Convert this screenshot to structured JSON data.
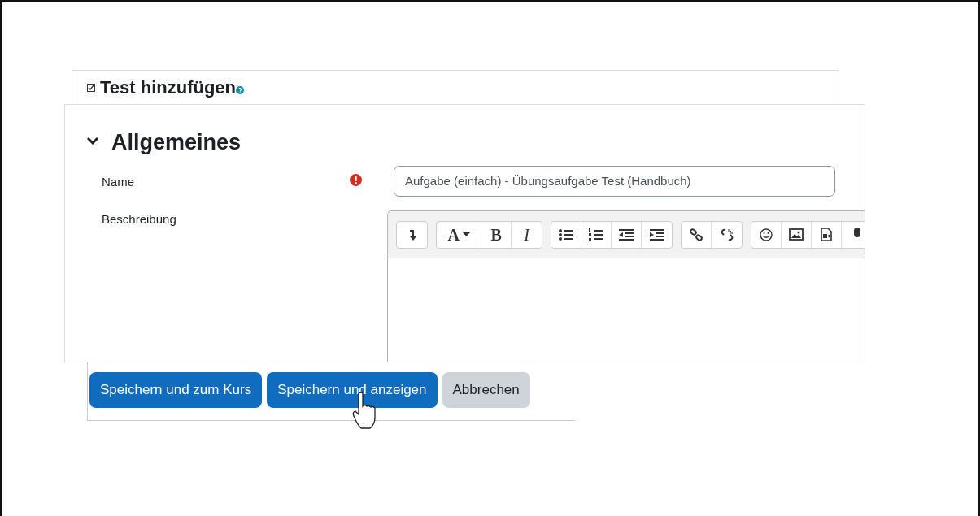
{
  "header": {
    "title": "Test hinzufügen"
  },
  "section": {
    "title": "Allgemeines",
    "expanded": true
  },
  "fields": [
    {
      "kind": "text",
      "label": "Name",
      "required": true,
      "value": "Aufgabe (einfach) - Übungsaufgabe Test (Handbuch)"
    },
    {
      "kind": "editor",
      "label": "Beschreibung",
      "required": false
    }
  ],
  "toolbar": [
    [
      {
        "kind": "collapse"
      }
    ],
    [
      {
        "kind": "font",
        "label": "A"
      },
      {
        "kind": "text",
        "label": "B"
      },
      {
        "kind": "italic",
        "label": "I"
      }
    ],
    [
      {
        "kind": "bullets"
      },
      {
        "kind": "numbers"
      },
      {
        "kind": "outdent"
      },
      {
        "kind": "indent"
      }
    ],
    [
      {
        "kind": "link"
      },
      {
        "kind": "unlink"
      }
    ],
    [
      {
        "kind": "emoji"
      },
      {
        "kind": "image"
      },
      {
        "kind": "media"
      },
      {
        "kind": "mic"
      }
    ]
  ],
  "buttons": [
    {
      "label": "Speichern und zum Kurs",
      "kind": "primary",
      "hovered": false
    },
    {
      "label": "Speichern und anzeigen",
      "kind": "primary",
      "hovered": true
    },
    {
      "label": "Abbrechen",
      "kind": "secondary",
      "hovered": false
    }
  ]
}
